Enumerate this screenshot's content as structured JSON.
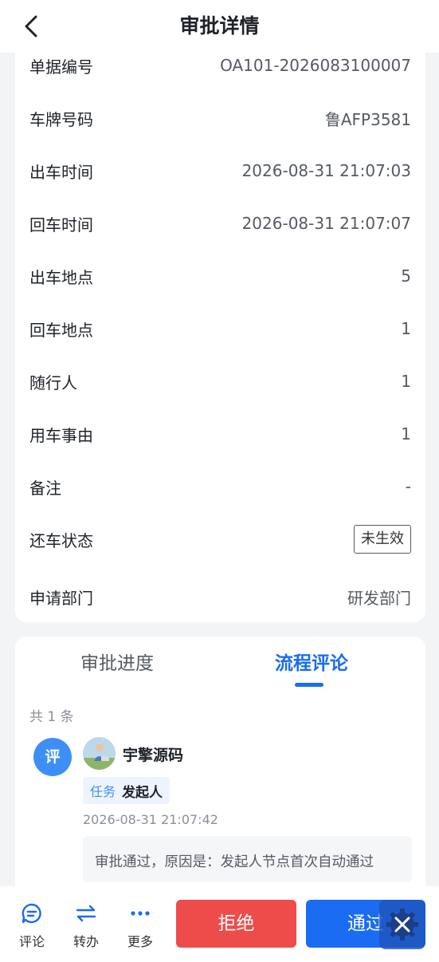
{
  "header": {
    "title": "审批详情"
  },
  "details": [
    {
      "label": "单据编号",
      "value": "OA101-2026083100007"
    },
    {
      "label": "车牌号码",
      "value": "鲁AFP3581"
    },
    {
      "label": "出车时间",
      "value": "2026-08-31 21:07:03"
    },
    {
      "label": "回车时间",
      "value": "2026-08-31 21:07:07"
    },
    {
      "label": "出车地点",
      "value": "5"
    },
    {
      "label": "回车地点",
      "value": "1"
    },
    {
      "label": "随行人",
      "value": "1"
    },
    {
      "label": "用车事由",
      "value": "1"
    },
    {
      "label": "备注",
      "value": "-"
    },
    {
      "label": "还车状态",
      "value": "未生效"
    },
    {
      "label": "申请部门",
      "value": "研发部门"
    }
  ],
  "tabs": [
    {
      "label": "审批进度"
    },
    {
      "label": "流程评论"
    }
  ],
  "comments": {
    "count_text": "共 1 条",
    "items": [
      {
        "badge": "评",
        "user": "宇擎源码",
        "task_label": "任务",
        "task_value": "发起人",
        "time": "2026-08-31 21:07:42",
        "content": "审批通过，原因是：发起人节点首次自动通过"
      }
    ]
  },
  "bottom": {
    "actions": [
      {
        "label": "评论",
        "icon": "comment-icon"
      },
      {
        "label": "转办",
        "icon": "transfer-icon"
      },
      {
        "label": "更多",
        "icon": "more-icon"
      }
    ],
    "reject_label": "拒绝",
    "approve_label": "通过"
  },
  "colors": {
    "primary": "#1a6cf2",
    "danger": "#ee4b4b",
    "badge": "#3d8ff5",
    "background": "#f3f4f6"
  }
}
